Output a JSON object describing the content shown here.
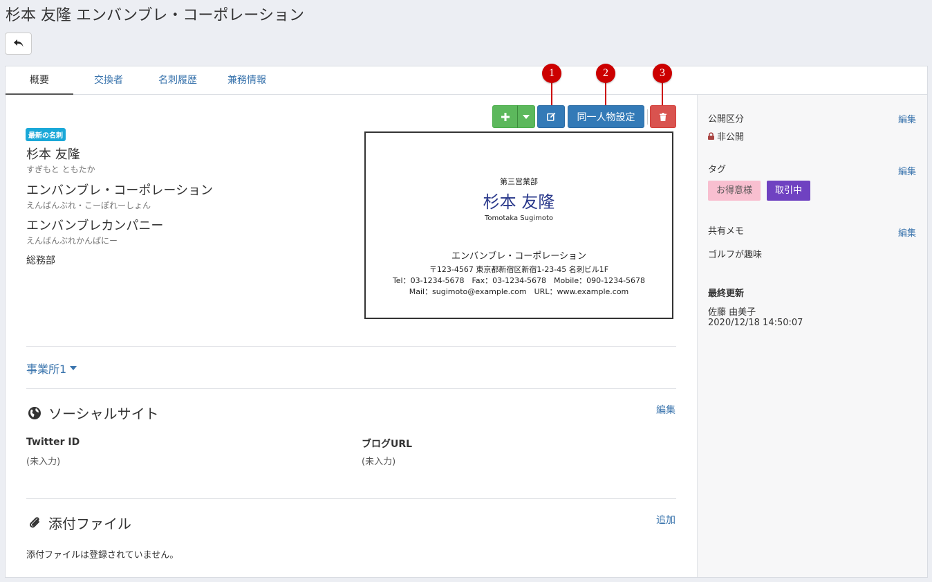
{
  "page": {
    "title": "杉本 友隆 エンバンブレ・コーポレーション"
  },
  "tabs": [
    {
      "label": "概要"
    },
    {
      "label": "交換者"
    },
    {
      "label": "名刺履歴"
    },
    {
      "label": "兼務情報"
    }
  ],
  "toolbar": {
    "same_person_label": "同一人物設定",
    "callouts": [
      "1",
      "2",
      "3"
    ]
  },
  "contact": {
    "latest_badge": "最新の名刺",
    "name": "杉本 友隆",
    "name_kana": "すぎもと ともたか",
    "company": "エンバンブレ・コーポレーション",
    "company_kana": "えんばんぶれ・こーぽれーしょん",
    "company2": "エンバンブレカンパニー",
    "company2_kana": "えんばんぶれかんぱにー",
    "department": "総務部"
  },
  "business_card": {
    "department": "第三営業部",
    "name": "杉本 友隆",
    "name_romaji": "Tomotaka Sugimoto",
    "company": "エンバンブレ・コーポレーション",
    "address": "〒123-4567 東京都新宿区新宿1-23-45 名刺ビル1F",
    "phones": "Tel：03-1234-5678　Fax：03-1234-5678　Mobile：090-1234-5678",
    "web": "Mail：sugimoto@example.com　URL：www.example.com"
  },
  "office": {
    "label": "事業所1"
  },
  "social": {
    "title": "ソーシャルサイト",
    "edit_label": "編集",
    "twitter_label": "Twitter ID",
    "twitter_value": "(未入力)",
    "blog_label": "ブログURL",
    "blog_value": "(未入力)"
  },
  "attachments": {
    "title": "添付ファイル",
    "add_label": "追加",
    "empty_text": "添付ファイルは登録されていません。"
  },
  "sidebar": {
    "visibility_label": "公開区分",
    "visibility_edit": "編集",
    "visibility_value": "非公開",
    "tags_label": "タグ",
    "tags_edit": "編集",
    "tags": [
      {
        "label": "お得意様",
        "bg": "#f8bfd0",
        "fg": "#555555"
      },
      {
        "label": "取引中",
        "bg": "#6f42c1",
        "fg": "#ffffff"
      }
    ],
    "memo_label": "共有メモ",
    "memo_edit": "編集",
    "memo_value": "ゴルフが趣味",
    "updated_label": "最終更新",
    "updated_by": "佐藤 由美子",
    "updated_at": "2020/12/18 14:50:07"
  },
  "icons": {
    "back": "back-arrow-icon",
    "add": "plus-icon",
    "dropdown": "caret-down-icon",
    "edit": "edit-icon",
    "delete": "trash-icon",
    "lock": "lock-icon",
    "globe": "globe-icon",
    "paperclip": "paperclip-icon"
  },
  "colors": {
    "accent": "#337ab7",
    "success": "#5cb85c",
    "danger": "#d9534f",
    "callout": "#cc0000"
  }
}
